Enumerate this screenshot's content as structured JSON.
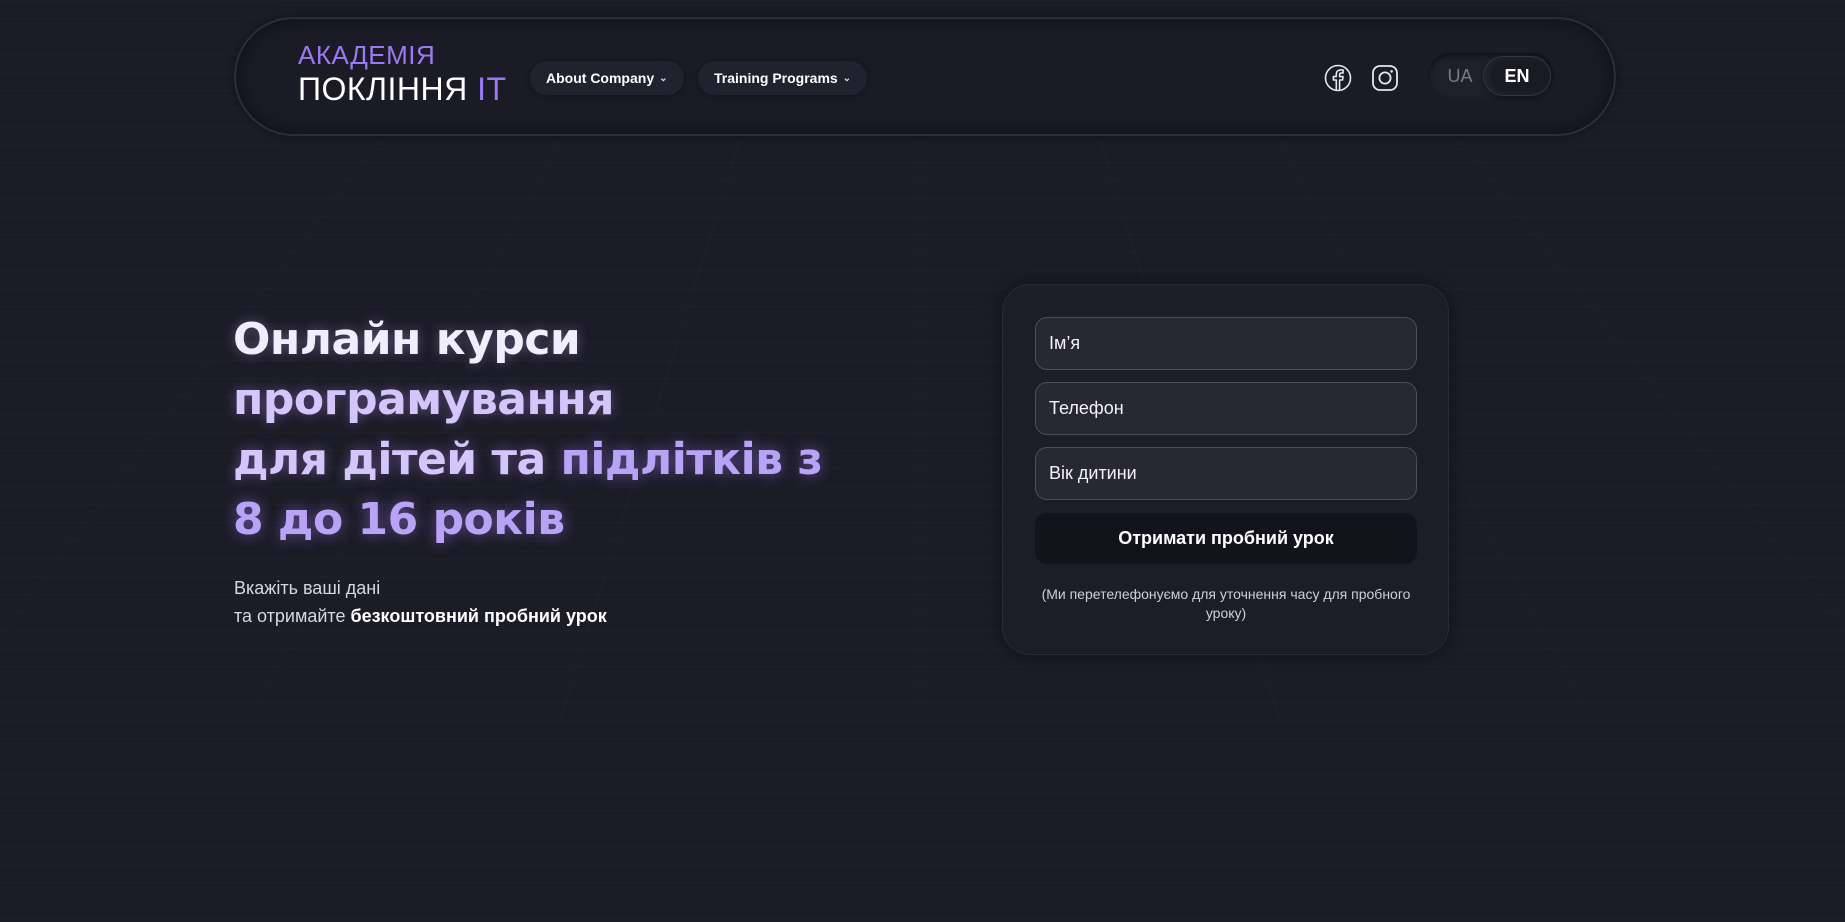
{
  "header": {
    "logo": {
      "line1": "АКАДЕМІЯ",
      "line2_main": "ПОКЛІННЯ",
      "line2_accent": "IT"
    },
    "nav": {
      "about_label": "About Company",
      "training_label": "Training Programs"
    },
    "social": {
      "facebook_icon": "facebook-icon",
      "instagram_icon": "instagram-icon"
    },
    "language": {
      "options": [
        "UA",
        "EN"
      ],
      "selected": "EN"
    }
  },
  "hero": {
    "title_line1": "Онлайн курси",
    "title_line2": "програмування",
    "title_line3_a": "для дітей та ",
    "title_line3_b": "підлітків з",
    "title_line4": "8 до 16 років",
    "subtitle_line1": "Вкажіть ваші дані",
    "subtitle_line2_prefix": "та отримайте ",
    "subtitle_line2_bold": "безкоштовний пробний урок"
  },
  "form": {
    "name_placeholder": "Ім’я",
    "phone_placeholder": "Телефон",
    "age_placeholder": "Вік дитини",
    "submit_label": "Отримати пробний урок",
    "note": "(Ми перетелефонуємо для уточнення часу для пробного уроку)"
  },
  "colors": {
    "background": "#1c1c27",
    "accent": "#9a79f4",
    "accent_light": "#b9a3f7",
    "button_bg": "#13131b",
    "field_bg": "#282833"
  }
}
